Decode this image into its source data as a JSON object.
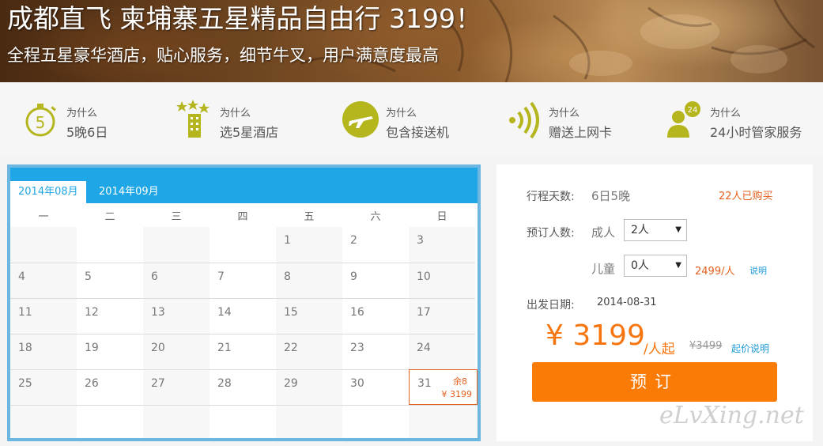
{
  "banner": {
    "title": "成都直飞 柬埔寨五星精品自由行 3199！",
    "subtitle": "全程五星豪华酒店，贴心服务，细节牛叉，用户满意度最高"
  },
  "features": [
    {
      "why": "为什么",
      "text": "5晚6日",
      "icon": "stopwatch-icon"
    },
    {
      "why": "为什么",
      "text": "选5星酒店",
      "icon": "hotel-stars-icon"
    },
    {
      "why": "为什么",
      "text": "包含接送机",
      "icon": "airplane-icon"
    },
    {
      "why": "为什么",
      "text": "赠送上网卡",
      "icon": "wifi-signal-icon"
    },
    {
      "why": "为什么",
      "text": "24小时管家服务",
      "icon": "butler-24-icon"
    }
  ],
  "calendar": {
    "tabs": [
      "2014年08月",
      "2014年09月"
    ],
    "weekdays": [
      "一",
      "二",
      "三",
      "四",
      "五",
      "六",
      "日"
    ],
    "selected_day": {
      "day": "31",
      "remaining": "余8",
      "price": "¥ 3199"
    },
    "days": [
      "1",
      "2",
      "3",
      "4",
      "5",
      "6",
      "7",
      "8",
      "9",
      "10",
      "11",
      "12",
      "13",
      "14",
      "15",
      "16",
      "17",
      "18",
      "19",
      "20",
      "21",
      "22",
      "23",
      "24",
      "25",
      "26",
      "27",
      "28",
      "29",
      "30",
      "31"
    ]
  },
  "booking": {
    "days_label": "行程天数:",
    "days_value": "6日5晚",
    "sold": "22人已购买",
    "people_label": "预订人数:",
    "adult_label": "成人",
    "adult_value": "2人",
    "child_label": "儿童",
    "child_value": "0人",
    "child_price": "2499/人",
    "child_note": "说明",
    "date_label": "出发日期:",
    "date_value": "2014-08-31",
    "price": "¥ 3199",
    "per": "/人起",
    "old_price": "¥3499",
    "price_note": "起价说明",
    "book_button": "预订"
  },
  "watermark": "eLvXing.net",
  "colors": {
    "accent_orange": "#fb7b07",
    "accent_blue": "#1fa6e6",
    "olive_icon": "#b5b51e",
    "red_text": "#e4601f"
  }
}
